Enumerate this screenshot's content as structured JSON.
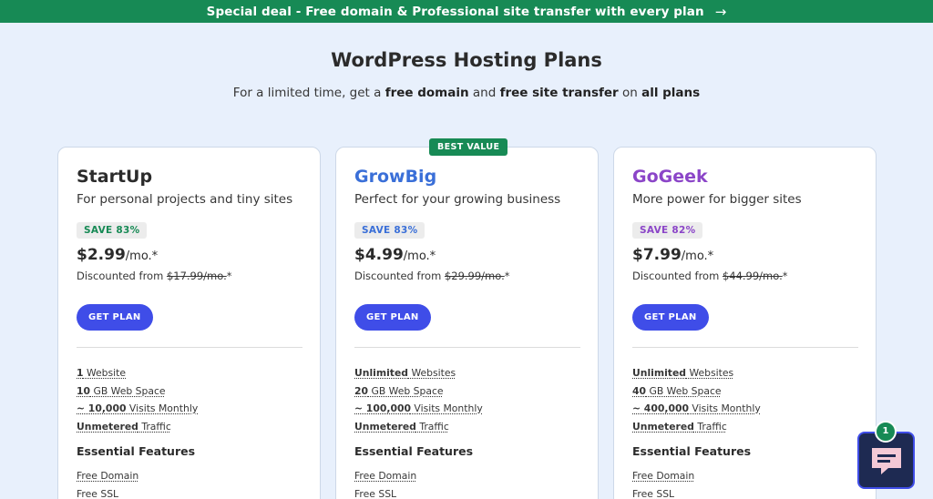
{
  "banner": {
    "text": "Special deal - Free domain & Professional site transfer with every plan",
    "arrow": "→"
  },
  "header": {
    "title": "WordPress Hosting Plans",
    "subtitle_parts": [
      "For a limited time, get a ",
      "free domain",
      " and ",
      "free site transfer",
      " on ",
      "all plans"
    ]
  },
  "best_value_label": "BEST VALUE",
  "get_plan_label": "GET PLAN",
  "discounted_from_label": "Discounted from",
  "essential_features_label": "Essential Features",
  "plans": [
    {
      "name": "StartUp",
      "name_color": "#2b2b2b",
      "description": "For personal projects and tiny sites",
      "save": "SAVE 83%",
      "save_color": "#178a55",
      "price": "$2.99",
      "price_unit": "/mo.*",
      "old_price": "$17.99/mo.",
      "old_suffix": "*",
      "features": [
        {
          "strong": "1",
          "rest": " Website"
        },
        {
          "strong": "10",
          "rest": " GB Web Space"
        },
        {
          "strong": "~ 10,000",
          "rest": " Visits Monthly"
        },
        {
          "strong": "Unmetered",
          "rest": " Traffic"
        }
      ],
      "essential": [
        "Free Domain",
        "Free SSL"
      ]
    },
    {
      "name": "GrowBig",
      "name_color": "#3a6fd8",
      "description": "Perfect for your growing business",
      "save": "SAVE 83%",
      "save_color": "#3a6fd8",
      "price": "$4.99",
      "price_unit": "/mo.*",
      "old_price": "$29.99/mo.",
      "old_suffix": "*",
      "features": [
        {
          "strong": "Unlimited",
          "rest": " Websites"
        },
        {
          "strong": "20",
          "rest": " GB Web Space"
        },
        {
          "strong": "~ 100,000",
          "rest": " Visits Monthly"
        },
        {
          "strong": "Unmetered",
          "rest": " Traffic"
        }
      ],
      "essential": [
        "Free Domain",
        "Free SSL"
      ]
    },
    {
      "name": "GoGeek",
      "name_color": "#8b45c8",
      "description": "More power for bigger sites",
      "save": "SAVE 82%",
      "save_color": "#8b45c8",
      "price": "$7.99",
      "price_unit": "/mo.*",
      "old_price": "$44.99/mo.",
      "old_suffix": "*",
      "features": [
        {
          "strong": "Unlimited",
          "rest": " Websites"
        },
        {
          "strong": "40",
          "rest": " GB Web Space"
        },
        {
          "strong": "~ 400,000",
          "rest": " Visits Monthly"
        },
        {
          "strong": "Unmetered",
          "rest": " Traffic"
        }
      ],
      "essential": [
        "Free Domain",
        "Free SSL"
      ]
    }
  ],
  "chat": {
    "icon": "chat-bubble-icon",
    "badge_count": "1"
  }
}
